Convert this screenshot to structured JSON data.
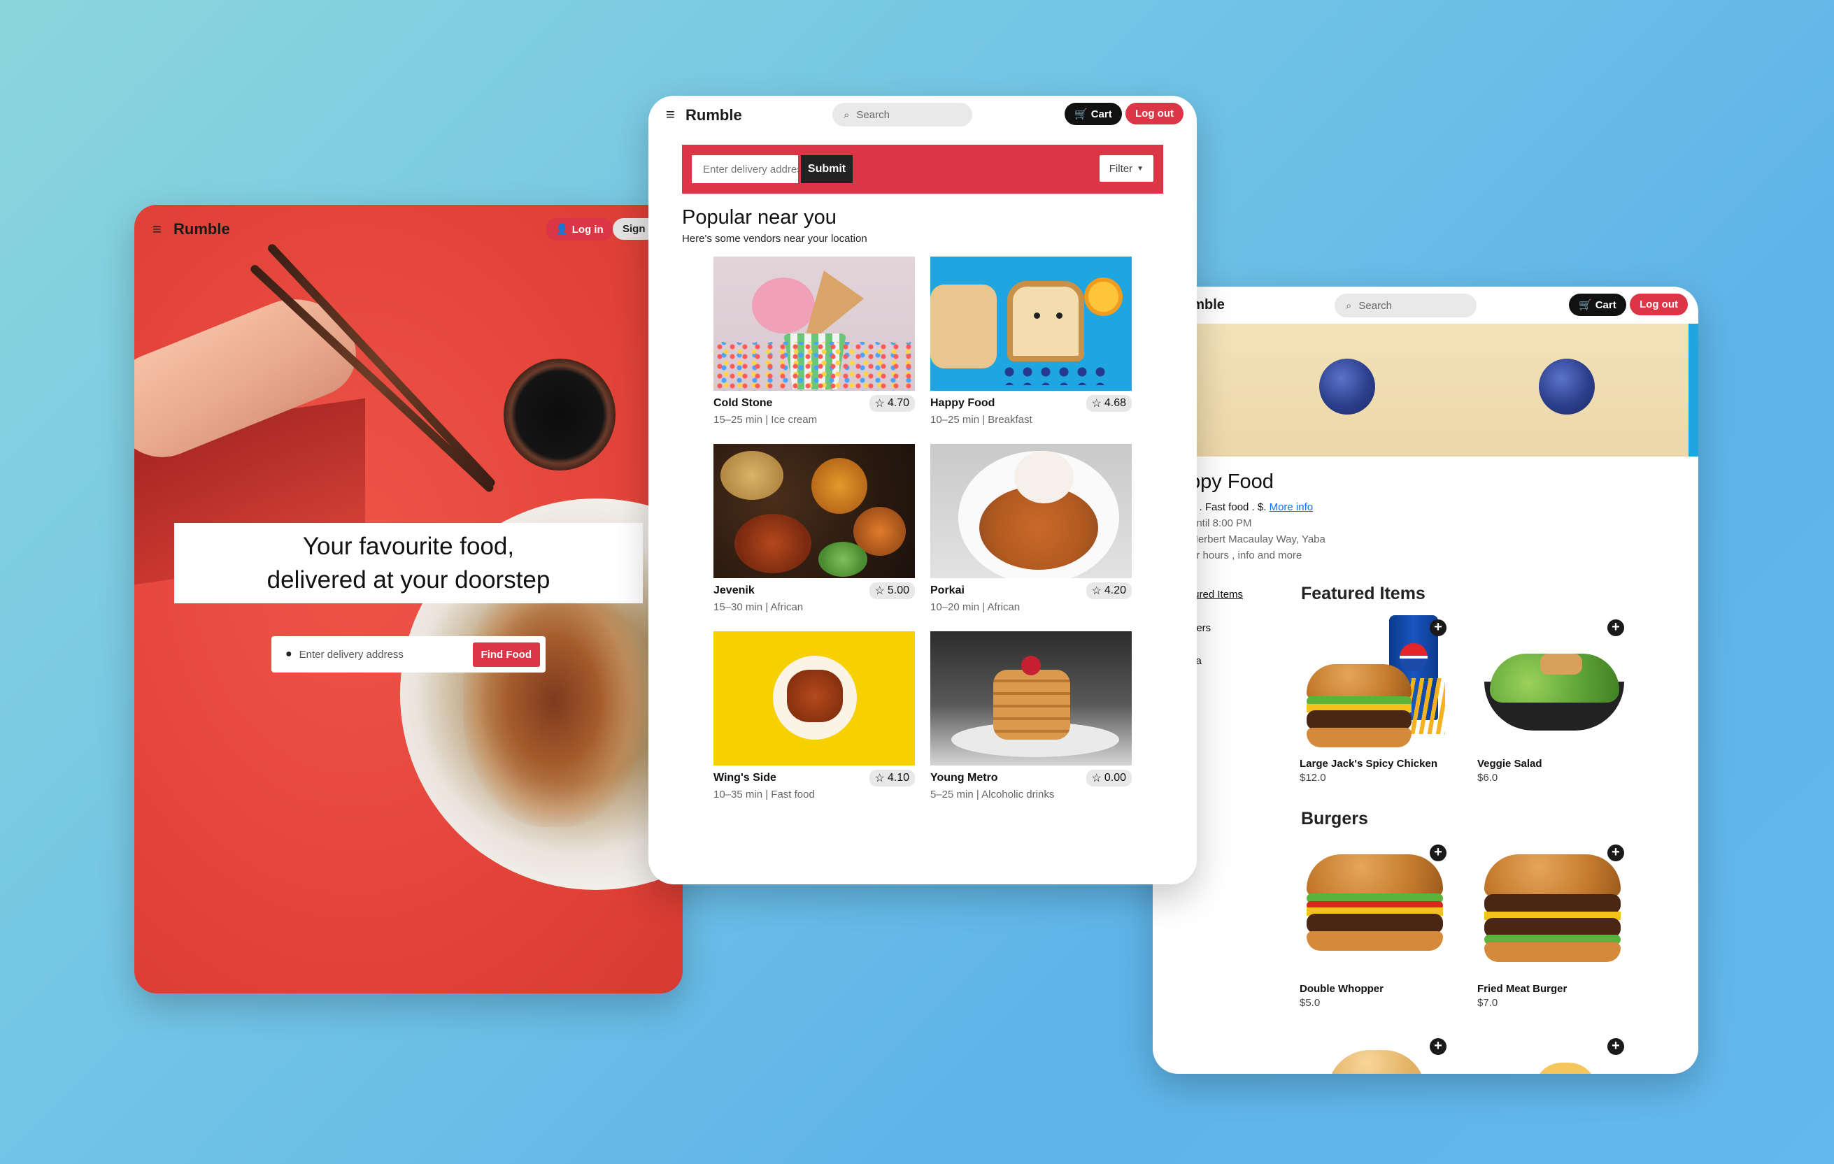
{
  "left_screen": {
    "brand": "Rumble",
    "menu_icon": "hamburger-icon",
    "login_label": "Log in",
    "signup_label": "Sign u",
    "hero_line1": "Your favourite food,",
    "hero_line2": "delivered at your doorstep",
    "address_placeholder": "Enter delivery address",
    "find_button": "Find Food"
  },
  "middle_screen": {
    "brand": "Rumble",
    "search_placeholder": "Search",
    "cart_label": "Cart",
    "logout_label": "Log out",
    "address_placeholder": "Enter delivery address",
    "submit_label": "Submit",
    "filter_label": "Filter",
    "title": "Popular near you",
    "subtitle": "Here's some vendors near your location",
    "vendors": [
      {
        "name": "Cold Stone",
        "rating": "4.70",
        "meta": "15–25 min | Ice cream"
      },
      {
        "name": "Happy Food",
        "rating": "4.68",
        "meta": "10–25 min | Breakfast"
      },
      {
        "name": "Jevenik",
        "rating": "5.00",
        "meta": "15–30 min | African"
      },
      {
        "name": "Porkai",
        "rating": "4.20",
        "meta": "10–20 min | African"
      },
      {
        "name": "Wing's Side",
        "rating": "4.10",
        "meta": "10–35 min | Fast food"
      },
      {
        "name": "Young Metro",
        "rating": "0.00",
        "meta": "5–25 min | Alcoholic drinks"
      }
    ]
  },
  "right_screen": {
    "brand_partial": "umble",
    "search_placeholder": "Search",
    "cart_label": "Cart",
    "logout_label": "Log out",
    "restaurant_name": "ppy Food",
    "info_line": "2 . Fast food . $.",
    "more_info_link": "More info",
    "hours": "until 8:00 PM",
    "address": "Herbert Macaulay Way, Yaba",
    "hours_note": "or hours , info and more",
    "sidebar": [
      "tured Items",
      "gers",
      "za"
    ],
    "featured_title": "Featured Items",
    "burgers_title": "Burgers",
    "featured_items": [
      {
        "name": "Large Jack's Spicy Chicken",
        "price": "$12.0"
      },
      {
        "name": "Veggie Salad",
        "price": "$6.0"
      }
    ],
    "burger_items": [
      {
        "name": "Double Whopper",
        "price": "$5.0"
      },
      {
        "name": "Fried Meat Burger",
        "price": "$7.0"
      }
    ]
  },
  "colors": {
    "accent_red": "#dc3545",
    "dark": "#111111",
    "background": "#6cc0e6"
  }
}
